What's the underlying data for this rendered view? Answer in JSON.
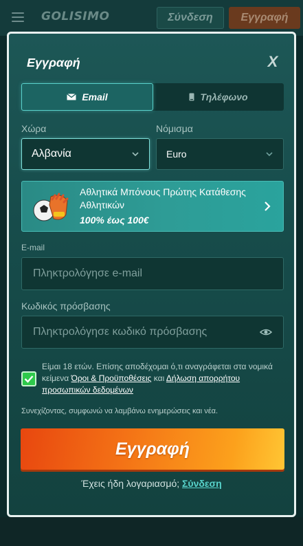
{
  "background": {
    "logo": "GOLISIMO",
    "login_label": "Σύνδεση",
    "register_label": "Εγγραφή"
  },
  "modal": {
    "title": "Εγγραφή",
    "close_label": "X"
  },
  "tabs": [
    {
      "label": "Email",
      "icon": "envelope-icon",
      "active": true
    },
    {
      "label": "Τηλέφωνο",
      "icon": "phone-icon",
      "active": false
    }
  ],
  "country": {
    "label": "Χώρα",
    "value": "Αλβανία"
  },
  "currency": {
    "label": "Νόμισμα",
    "value": "Euro"
  },
  "bonus": {
    "text": "Αθλητικά Μπόνους Πρώτης Κατάθεσης Αθλητικών",
    "amount": "100% έως 100€",
    "icon": "goalkeeper-glove-ball-icon"
  },
  "email": {
    "label": "E-mail",
    "placeholder": "Πληκτρολόγησε e-mail"
  },
  "password": {
    "label": "Κωδικός πρόσβασης",
    "placeholder": "Πληκτρολόγησε κωδικό πρόσβασης",
    "icon": "eye-icon"
  },
  "terms": {
    "checked": true,
    "prefix": "Είμαι 18 ετών. Επίσης αποδέχομαι ό,τι αναγράφεται στα νομικά κείμενα ",
    "terms_link": "Όροι & Προϋποθέσεις",
    "connector": " και ",
    "privacy_link": "Δήλωση απορρήτου προσωπικών δεδομένων"
  },
  "newsletter_text": "Συνεχίζοντας, συμφωνώ να λαμβάνω ενημερώσεις και νέα.",
  "register_button": "Εγγραφή",
  "login_prompt": {
    "text": "Έχεις ήδη λογαριασμό;",
    "link": "Σύνδεση"
  },
  "colors": {
    "accent": "#58d4cc",
    "cta_start": "#e8470f",
    "cta_end": "#ffc634",
    "checkbox": "#2ec94b"
  }
}
